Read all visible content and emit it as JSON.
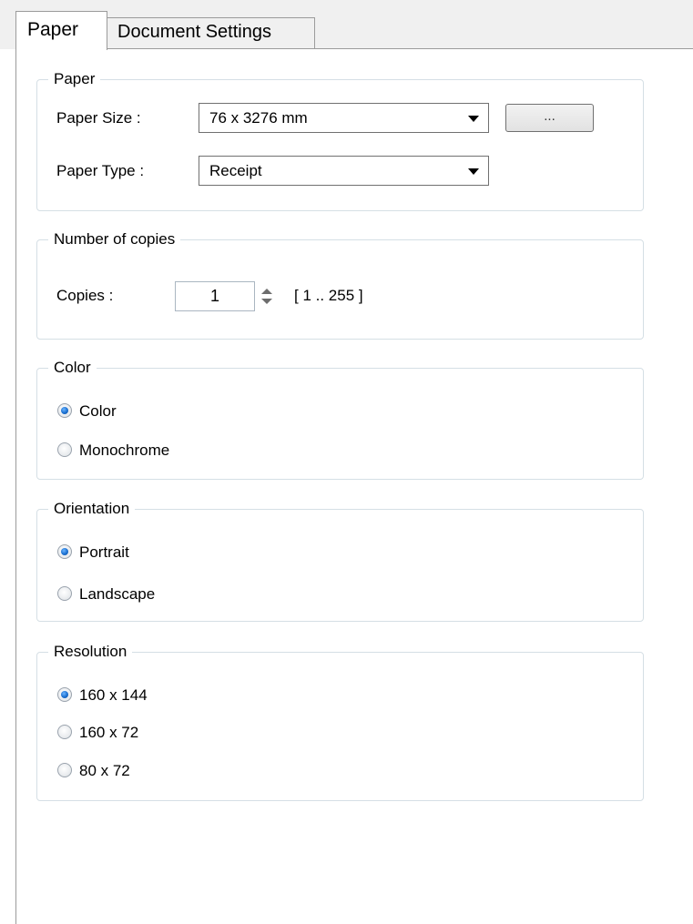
{
  "tabs": [
    {
      "label": "Paper",
      "active": true
    },
    {
      "label": "Document Settings",
      "active": false
    }
  ],
  "paper_group": {
    "title": "Paper",
    "paper_size_label": "Paper Size :",
    "paper_size_value": "76 x 3276 mm",
    "more_button_label": "...",
    "paper_type_label": "Paper Type :",
    "paper_type_value": "Receipt"
  },
  "copies_group": {
    "title": "Number of copies",
    "copies_label": "Copies :",
    "copies_value": "1",
    "copies_range": "[ 1 .. 255 ]"
  },
  "color_group": {
    "title": "Color",
    "options": [
      {
        "label": "Color",
        "selected": true
      },
      {
        "label": "Monochrome",
        "selected": false
      }
    ]
  },
  "orientation_group": {
    "title": "Orientation",
    "options": [
      {
        "label": "Portrait",
        "selected": true
      },
      {
        "label": "Landscape",
        "selected": false
      }
    ]
  },
  "resolution_group": {
    "title": "Resolution",
    "options": [
      {
        "label": "160 x 144",
        "selected": true
      },
      {
        "label": "160 x 72",
        "selected": false
      },
      {
        "label": "80 x 72",
        "selected": false
      }
    ]
  },
  "colors": {
    "tab_border": "#9b9b9b",
    "group_border": "#d5dfe5",
    "radio_selected": "#1a6fd0"
  }
}
